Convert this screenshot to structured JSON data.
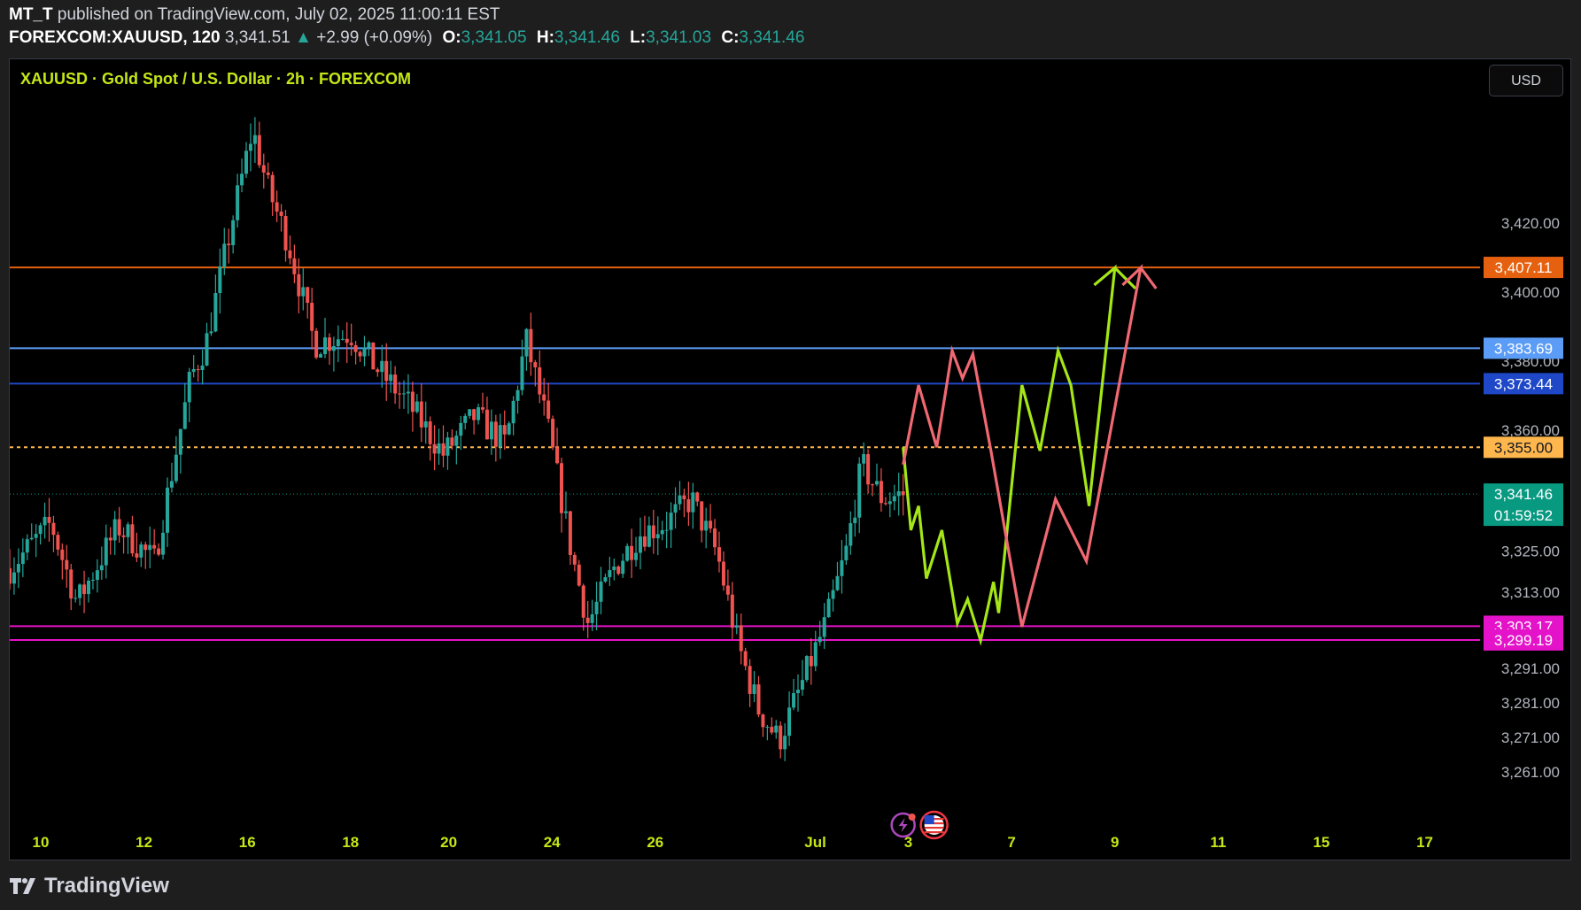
{
  "header": {
    "publisher": "MT_T",
    "published_text": "published on TradingView.com, July 02, 2025 11:00:11 EST",
    "symbol": "FOREXCOM:XAUUSD, 120",
    "last": "3,341.51",
    "change_arrow": "▲",
    "change": "+2.99 (+0.09%)",
    "o_label": "O:",
    "o": "3,341.05",
    "h_label": "H:",
    "h": "3,341.46",
    "l_label": "L:",
    "l": "3,341.03",
    "c_label": "C:",
    "c": "3,341.46"
  },
  "legend": "XAUUSD · Gold Spot / U.S. Dollar · 2h · FOREXCOM",
  "currency_button": "USD",
  "brand": "TradingView",
  "icons": [
    "lightning-event-icon",
    "us-flag-event-icon",
    "tradingview-logo-icon"
  ],
  "colors": {
    "up": "#26a69a",
    "down": "#ef5350",
    "green_path": "#a5e617",
    "red_path": "#f06872"
  },
  "chart_data": {
    "type": "candlestick",
    "title": "XAUUSD · Gold Spot / U.S. Dollar · 2h · FOREXCOM",
    "ylim": [
      3252,
      3452
    ],
    "y_ticks": [
      3420,
      3400,
      3380,
      3360,
      3325,
      3313,
      3291,
      3281,
      3271,
      3261
    ],
    "x_ticks": [
      {
        "label": "10",
        "x": 0
      },
      {
        "label": "12",
        "x": 2
      },
      {
        "label": "16",
        "x": 4
      },
      {
        "label": "18",
        "x": 6
      },
      {
        "label": "20",
        "x": 7.9
      },
      {
        "label": "24",
        "x": 9.9
      },
      {
        "label": "26",
        "x": 11.9
      },
      {
        "label": "Jul",
        "x": 15
      },
      {
        "label": "3",
        "x": 16.8
      },
      {
        "label": "7",
        "x": 18.8
      },
      {
        "label": "9",
        "x": 20.8
      },
      {
        "label": "11",
        "x": 22.8
      },
      {
        "label": "15",
        "x": 24.8
      },
      {
        "label": "17",
        "x": 26.8
      }
    ],
    "x_range": [
      -0.6,
      27.7
    ],
    "levels": [
      {
        "value": 3407.11,
        "label": "3,407.11",
        "color": "#e6610f",
        "style": "solid"
      },
      {
        "value": 3383.69,
        "label": "3,383.69",
        "color": "#5b9cf6",
        "style": "solid"
      },
      {
        "value": 3373.44,
        "label": "3,373.44",
        "color": "#1e48c8",
        "style": "solid"
      },
      {
        "value": 3355.0,
        "label": "3,355.00",
        "color": "#ffb74d",
        "style": "dashed"
      },
      {
        "value": 3303.17,
        "label": "3,303.17",
        "color": "#e412c8",
        "style": "solid"
      },
      {
        "value": 3299.19,
        "label": "3,299.19",
        "color": "#e412c8",
        "style": "solid"
      }
    ],
    "current_price": {
      "value": 3341.46,
      "label": "3,341.46",
      "countdown": "01:59:52",
      "color": "#089981"
    },
    "price_path": [
      {
        "x": -0.6,
        "y": 3320
      },
      {
        "x": 0.2,
        "y": 3333
      },
      {
        "x": 0.7,
        "y": 3310
      },
      {
        "x": 1.5,
        "y": 3332
      },
      {
        "x": 2.2,
        "y": 3322
      },
      {
        "x": 2.9,
        "y": 3375
      },
      {
        "x": 3.2,
        "y": 3385
      },
      {
        "x": 3.7,
        "y": 3420
      },
      {
        "x": 4.1,
        "y": 3447
      },
      {
        "x": 4.4,
        "y": 3430
      },
      {
        "x": 4.8,
        "y": 3414
      },
      {
        "x": 5.3,
        "y": 3385
      },
      {
        "x": 6.0,
        "y": 3388
      },
      {
        "x": 6.5,
        "y": 3378
      },
      {
        "x": 7.1,
        "y": 3368
      },
      {
        "x": 7.8,
        "y": 3353
      },
      {
        "x": 8.4,
        "y": 3364
      },
      {
        "x": 9.0,
        "y": 3356
      },
      {
        "x": 9.4,
        "y": 3386
      },
      {
        "x": 9.8,
        "y": 3362
      },
      {
        "x": 10.3,
        "y": 3323
      },
      {
        "x": 10.6,
        "y": 3304
      },
      {
        "x": 11.1,
        "y": 3320
      },
      {
        "x": 11.6,
        "y": 3330
      },
      {
        "x": 12.1,
        "y": 3333
      },
      {
        "x": 12.6,
        "y": 3340
      },
      {
        "x": 13.1,
        "y": 3324
      },
      {
        "x": 13.5,
        "y": 3298
      },
      {
        "x": 13.9,
        "y": 3279
      },
      {
        "x": 14.3,
        "y": 3270
      },
      {
        "x": 14.7,
        "y": 3285
      },
      {
        "x": 15.2,
        "y": 3304
      },
      {
        "x": 15.6,
        "y": 3325
      },
      {
        "x": 15.9,
        "y": 3350
      },
      {
        "x": 16.3,
        "y": 3340
      },
      {
        "x": 16.7,
        "y": 3341.46
      }
    ],
    "projections": [
      {
        "name": "",
        "color": "#a5e617",
        "points": [
          {
            "x": 16.7,
            "y": 3355
          },
          {
            "x": 16.85,
            "y": 3331
          },
          {
            "x": 17.0,
            "y": 3338
          },
          {
            "x": 17.15,
            "y": 3317
          },
          {
            "x": 17.45,
            "y": 3331
          },
          {
            "x": 17.75,
            "y": 3304
          },
          {
            "x": 17.95,
            "y": 3311
          },
          {
            "x": 18.2,
            "y": 3299
          },
          {
            "x": 18.45,
            "y": 3316
          },
          {
            "x": 18.55,
            "y": 3307
          },
          {
            "x": 19.0,
            "y": 3373
          },
          {
            "x": 19.35,
            "y": 3354
          },
          {
            "x": 19.7,
            "y": 3383
          },
          {
            "x": 19.95,
            "y": 3373
          },
          {
            "x": 20.3,
            "y": 3338
          },
          {
            "x": 20.8,
            "y": 3407
          },
          {
            "x": 20.4,
            "y": 3402
          },
          {
            "x": 20.8,
            "y": 3407
          },
          {
            "x": 21.2,
            "y": 3401
          }
        ]
      },
      {
        "name": "",
        "color": "#f06872",
        "points": [
          {
            "x": 16.7,
            "y": 3350
          },
          {
            "x": 17.0,
            "y": 3373
          },
          {
            "x": 17.35,
            "y": 3355
          },
          {
            "x": 17.65,
            "y": 3383
          },
          {
            "x": 17.85,
            "y": 3375
          },
          {
            "x": 18.05,
            "y": 3382
          },
          {
            "x": 18.4,
            "y": 3354
          },
          {
            "x": 19.0,
            "y": 3303
          },
          {
            "x": 19.65,
            "y": 3340
          },
          {
            "x": 20.25,
            "y": 3322
          },
          {
            "x": 21.3,
            "y": 3407
          },
          {
            "x": 20.95,
            "y": 3402
          },
          {
            "x": 21.3,
            "y": 3407
          },
          {
            "x": 21.6,
            "y": 3401
          }
        ]
      }
    ],
    "event_markers": [
      {
        "icon": "lightning-event-icon",
        "x": 16.7
      },
      {
        "icon": "us-flag-event-icon",
        "x": 17.3
      }
    ]
  }
}
